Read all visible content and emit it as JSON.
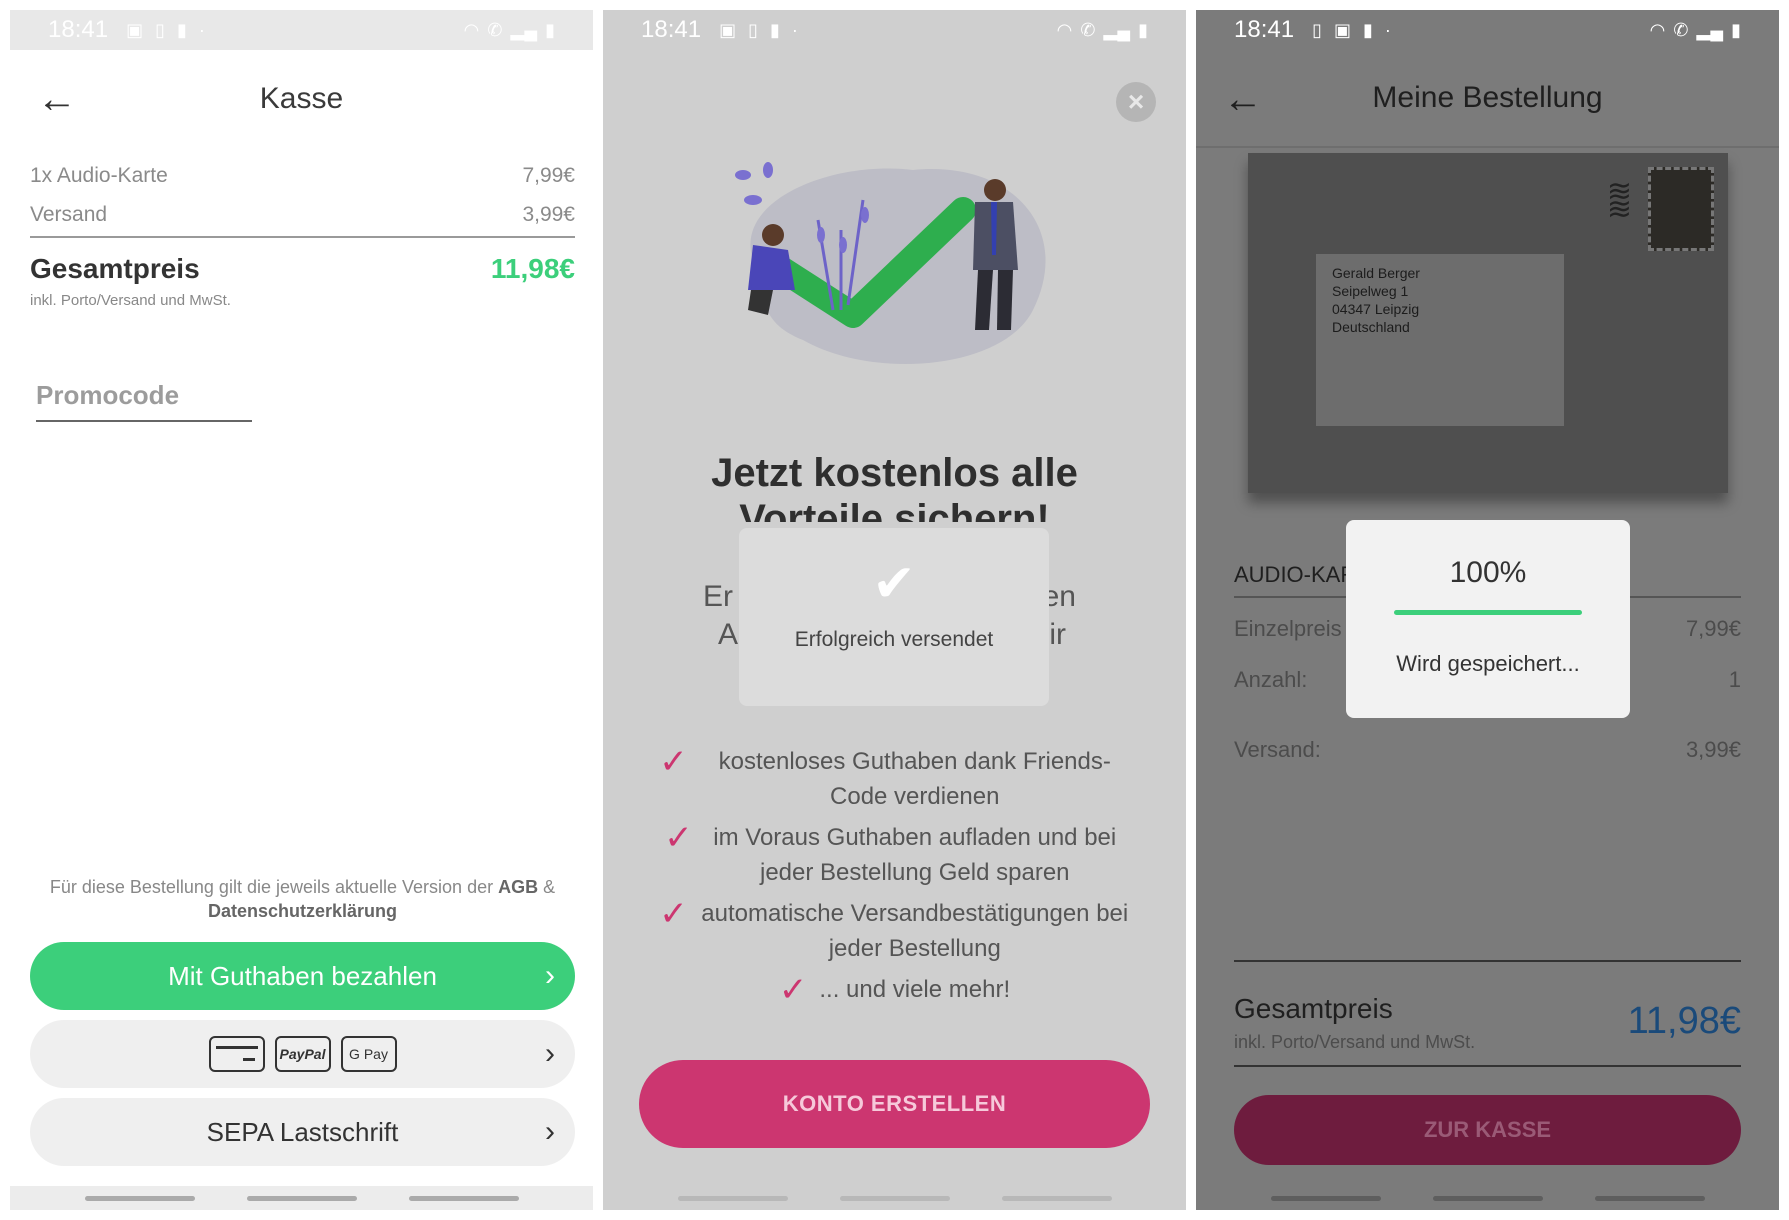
{
  "screen1": {
    "status": {
      "time": "18:41"
    },
    "title": "Kasse",
    "items": [
      {
        "label": "1x Audio-Karte",
        "price": "7,99€"
      },
      {
        "label": "Versand",
        "price": "3,99€"
      }
    ],
    "total": {
      "label": "Gesamtpreis",
      "value": "11,98€",
      "sub": "inkl. Porto/Versand und MwSt."
    },
    "promo_placeholder": "Promocode",
    "legal": {
      "prefix": "Für diese Bestellung gilt die jeweils aktuelle Version der",
      "agb": "AGB",
      "amp": "&",
      "privacy": "Datenschutzerklärung"
    },
    "buttons": {
      "guthaben": "Mit Guthaben bezahlen",
      "paypal": "PayPal",
      "gpay": "G Pay",
      "sepa": "SEPA Lastschrift",
      "chevron": "›"
    },
    "colors": {
      "accent": "#3ccf7b"
    }
  },
  "screen2": {
    "status": {
      "time": "18:41"
    },
    "close": "×",
    "headline": "Jetzt kostenlos alle Vorteile sichern!",
    "subline": {
      "left1": "Er",
      "right1": "en",
      "left2": "A",
      "right2": "ir"
    },
    "toast": {
      "text": "Erfolgreich versendet"
    },
    "benefits": [
      "kostenloses Guthaben dank Friends-Code verdienen",
      "im Voraus Guthaben aufladen und bei jeder Bestellung Geld sparen",
      "automatische Versandbestätigungen bei jeder Bestellung",
      "... und viele mehr!"
    ],
    "cta": "KONTO ERSTELLEN",
    "colors": {
      "primary": "#cc3670"
    }
  },
  "screen3": {
    "status": {
      "time": "18:41"
    },
    "title": "Meine Bestellung",
    "address": [
      "Gerald Berger",
      "Seipelweg 1",
      "04347 Leipzig",
      "Deutschland"
    ],
    "section_title": "AUDIO-KAR",
    "rows": [
      {
        "label": "Einzelpreis",
        "value": "7,99€"
      },
      {
        "label": "Anzahl:",
        "value": "1"
      },
      {
        "label": "Versand:",
        "value": "3,99€"
      }
    ],
    "total": {
      "label": "Gesamtpreis",
      "sub": "inkl. Porto/Versand und MwSt.",
      "value": "11,98€"
    },
    "cta": "ZUR KASSE",
    "progress": {
      "percent_label": "100%",
      "fraction": 1.0,
      "text": "Wird gespeichert..."
    }
  }
}
